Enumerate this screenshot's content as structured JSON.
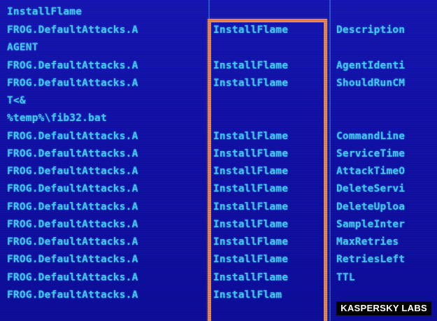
{
  "screen": {
    "background_color": "#1212a8",
    "text_color": "#46cbf6",
    "highlight_color": "#e58855"
  },
  "lines": [
    {
      "text": "InstallFlame"
    },
    {
      "col1": "FROG.DefaultAttacks.A",
      "col2": "InstallFlame",
      "col3": "Description"
    },
    {
      "text": "AGENT"
    },
    {
      "col1": "FROG.DefaultAttacks.A",
      "col2": "InstallFlame",
      "col3": "AgentIdenti"
    },
    {
      "col1": "FROG.DefaultAttacks.A",
      "col2": "InstallFlame",
      "col3": "ShouldRunCM"
    },
    {
      "text": "T<&"
    },
    {
      "text": "%temp%\\fib32.bat"
    },
    {
      "col1": "FROG.DefaultAttacks.A",
      "col2": "InstallFlame",
      "col3": "CommandLine"
    },
    {
      "col1": "FROG.DefaultAttacks.A",
      "col2": "InstallFlame",
      "col3": "ServiceTime"
    },
    {
      "col1": "FROG.DefaultAttacks.A",
      "col2": "InstallFlame",
      "col3": "AttackTimeO"
    },
    {
      "col1": "FROG.DefaultAttacks.A",
      "col2": "InstallFlame",
      "col3": "DeleteServi"
    },
    {
      "col1": "FROG.DefaultAttacks.A",
      "col2": "InstallFlame",
      "col3": "DeleteUploa"
    },
    {
      "col1": "FROG.DefaultAttacks.A",
      "col2": "InstallFlame",
      "col3": "SampleInter"
    },
    {
      "col1": "FROG.DefaultAttacks.A",
      "col2": "InstallFlame",
      "col3": "MaxRetries"
    },
    {
      "col1": "FROG.DefaultAttacks.A",
      "col2": "InstallFlame",
      "col3": "RetriesLeft"
    },
    {
      "col1": "FROG.DefaultAttacks.A",
      "col2": "InstallFlame",
      "col3": "TTL"
    },
    {
      "col1": "FROG.DefaultAttacks.A",
      "col2": "InstallFlam",
      "col3": ""
    }
  ],
  "watermark": {
    "text": "KASPERSKY LABS"
  }
}
